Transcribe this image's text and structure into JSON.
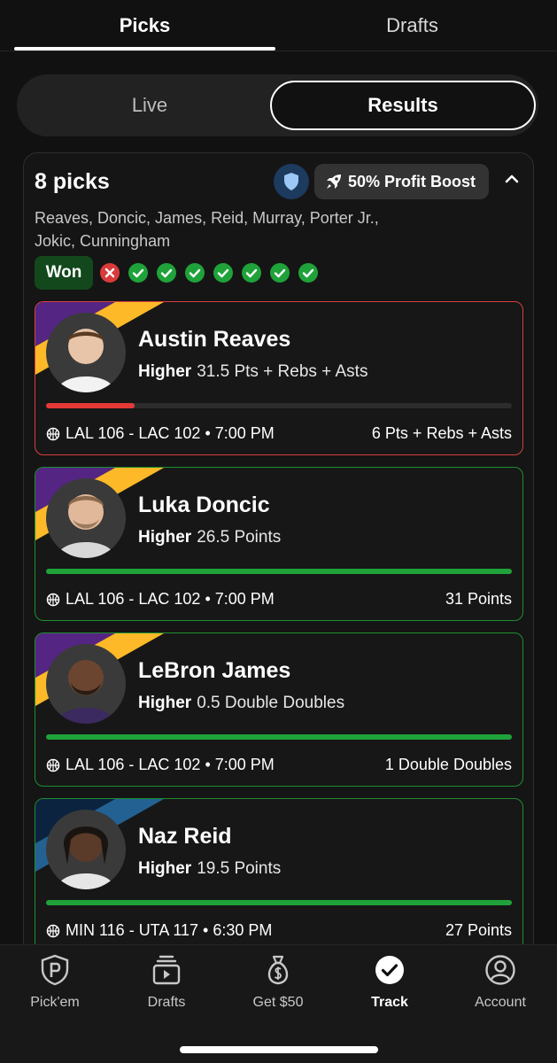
{
  "top_tabs": [
    {
      "label": "Picks",
      "active": true
    },
    {
      "label": "Drafts",
      "active": false
    }
  ],
  "segment": {
    "live": "Live",
    "results": "Results",
    "selected": "Results"
  },
  "entry": {
    "title": "8 picks",
    "boost_label": "50% Profit Boost",
    "player_names": "Reaves, Doncic, James, Reid, Murray, Porter Jr., Jokic, Cunningham",
    "status": "Won",
    "pick_results": [
      "loss",
      "win",
      "win",
      "win",
      "win",
      "win",
      "win",
      "win"
    ]
  },
  "picks": [
    {
      "name": "Austin Reaves",
      "direction": "Higher",
      "line": "31.5 Pts + Rebs + Asts",
      "game": "LAL 106 - LAC 102 • 7:00 PM",
      "result": "6 Pts + Rebs + Asts",
      "progress": 0.19,
      "outcome": "loss",
      "team_colors": [
        "#552583",
        "#FDB927"
      ]
    },
    {
      "name": "Luka Doncic",
      "direction": "Higher",
      "line": "26.5 Points",
      "game": "LAL 106 - LAC 102 • 7:00 PM",
      "result": "31 Points",
      "progress": 1.0,
      "outcome": "win",
      "team_colors": [
        "#552583",
        "#FDB927"
      ]
    },
    {
      "name": "LeBron James",
      "direction": "Higher",
      "line": "0.5 Double Doubles",
      "game": "LAL 106 - LAC 102 • 7:00 PM",
      "result": "1 Double Doubles",
      "progress": 1.0,
      "outcome": "win",
      "team_colors": [
        "#552583",
        "#FDB927"
      ]
    },
    {
      "name": "Naz Reid",
      "direction": "Higher",
      "line": "19.5 Points",
      "game": "MIN 116 - UTA 117 • 6:30 PM",
      "result": "27 Points",
      "progress": 1.0,
      "outcome": "win",
      "team_colors": [
        "#0C2340",
        "#236192"
      ]
    }
  ],
  "bottom_nav": [
    {
      "label": "Pick'em",
      "icon": "pickem-icon",
      "active": false
    },
    {
      "label": "Drafts",
      "icon": "drafts-icon",
      "active": false
    },
    {
      "label": "Get $50",
      "icon": "money-bag-icon",
      "active": false
    },
    {
      "label": "Track",
      "icon": "track-check-icon",
      "active": true
    },
    {
      "label": "Account",
      "icon": "account-icon",
      "active": false
    }
  ],
  "colors": {
    "win": "#1fa23a",
    "loss": "#e53935",
    "accent": "#ffffff"
  }
}
